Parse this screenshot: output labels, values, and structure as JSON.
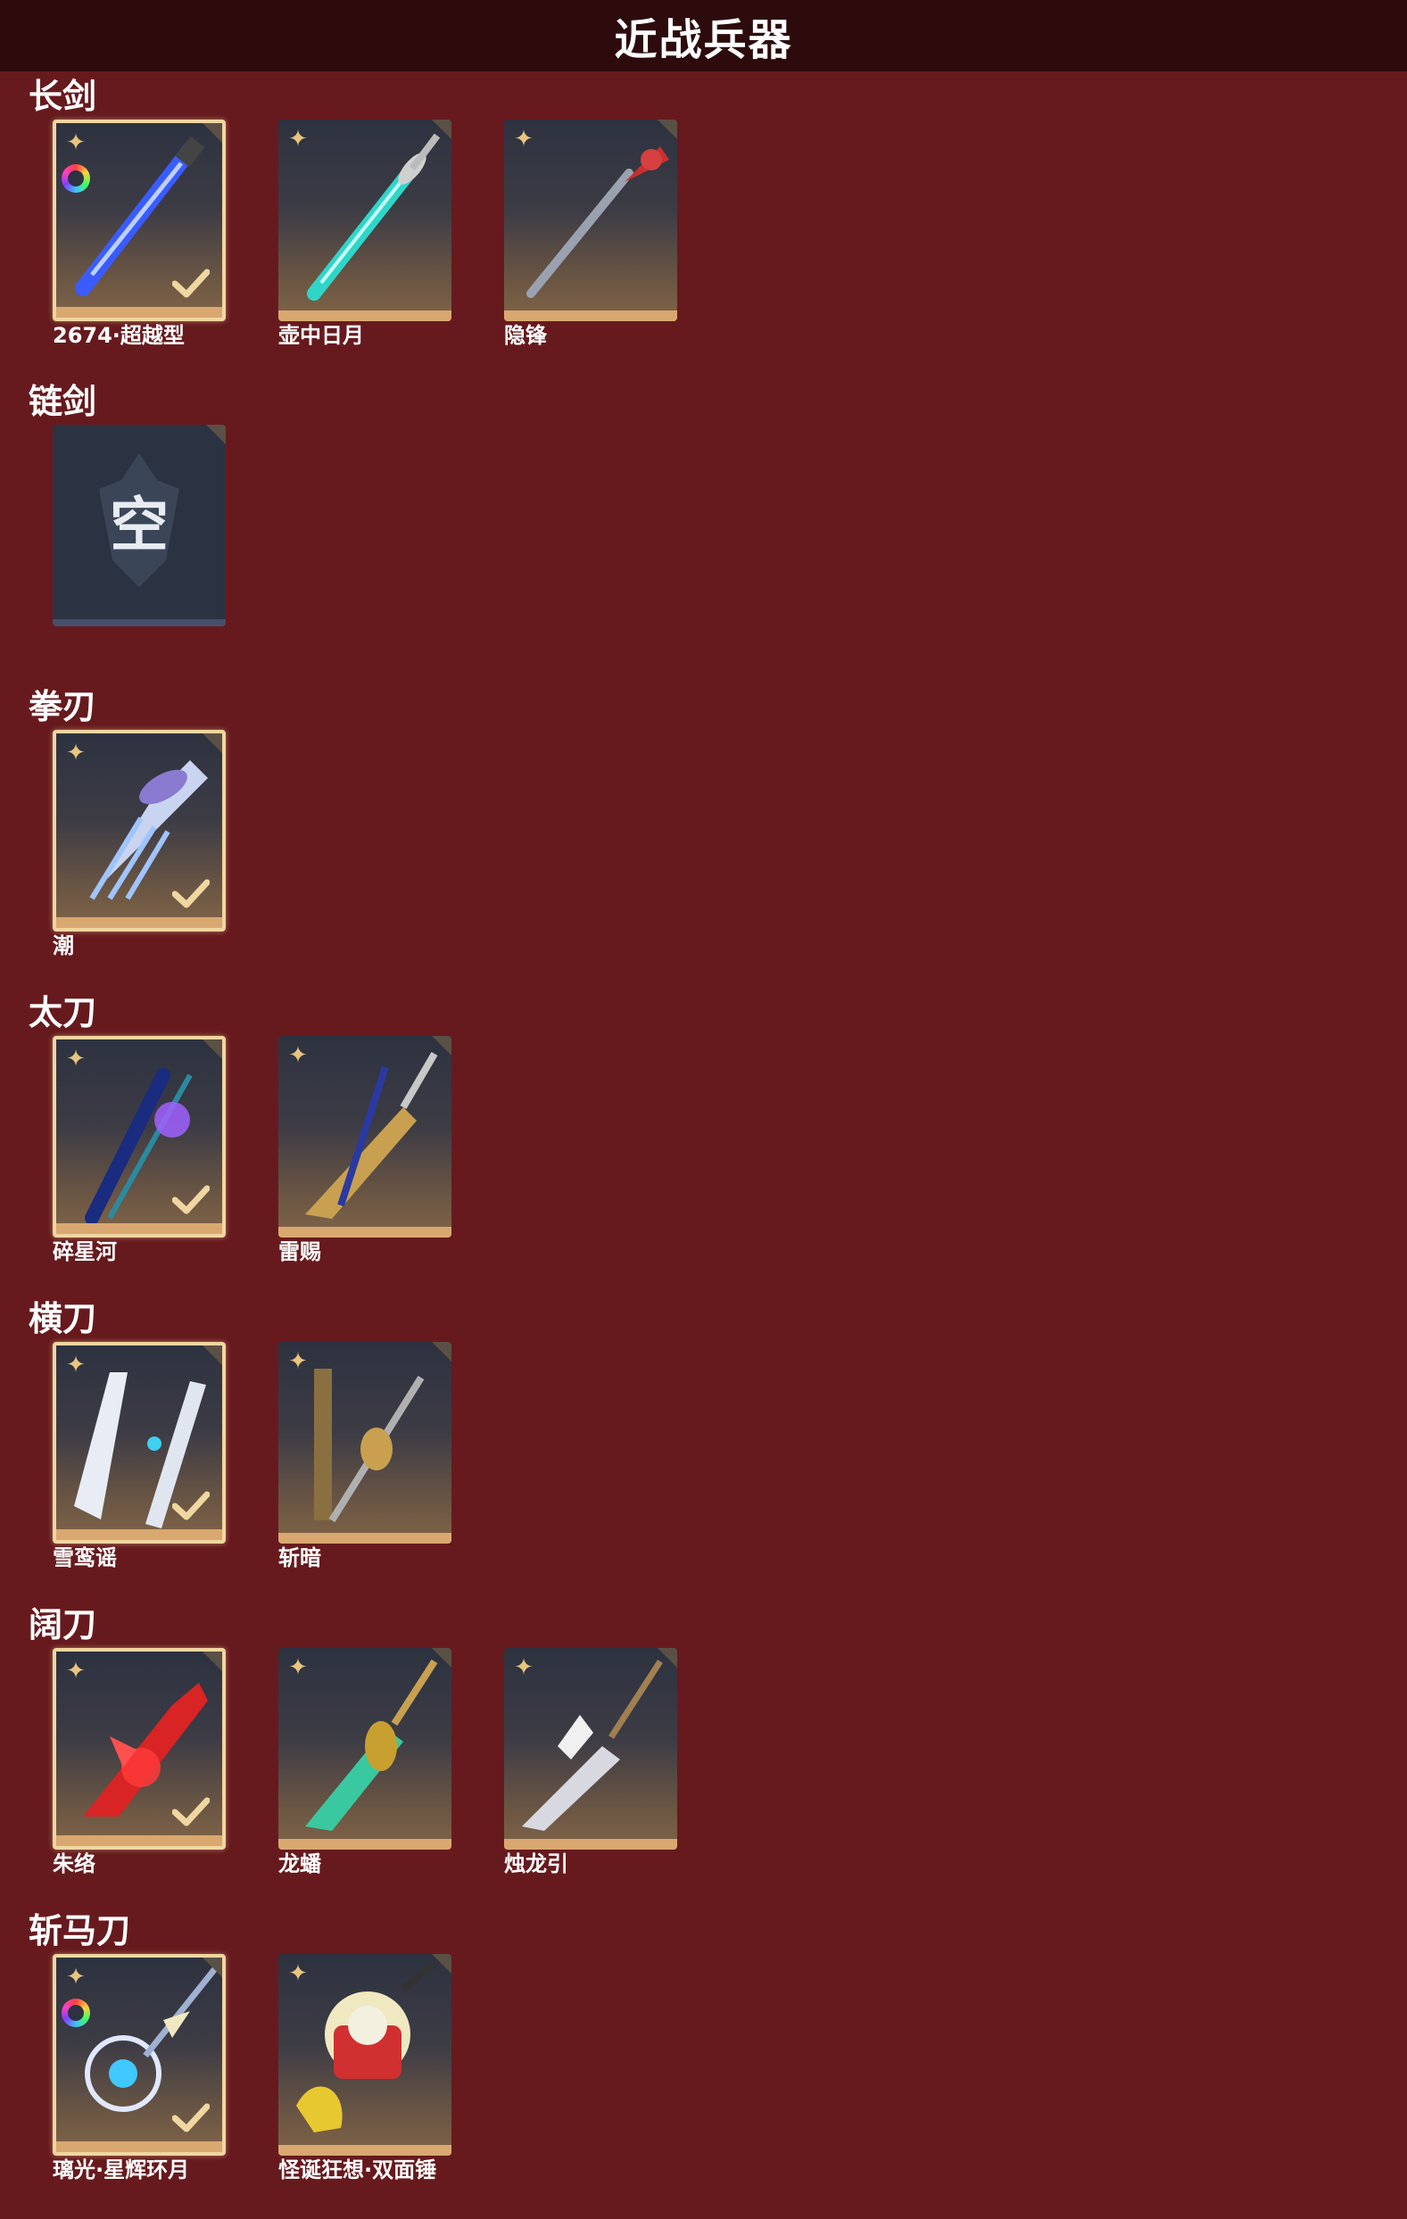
{
  "header": {
    "title": "近战兵器"
  },
  "sections": [
    {
      "title": "长剑",
      "items": [
        {
          "label": "2674·超越型",
          "selected": true,
          "rainbow": true,
          "weapon": "blue-sword"
        },
        {
          "label": "壶中日月",
          "selected": false,
          "rainbow": false,
          "weapon": "teal-sword"
        },
        {
          "label": "隐锋",
          "selected": false,
          "rainbow": false,
          "weapon": "red-sword"
        }
      ]
    },
    {
      "title": "链剑",
      "items": [
        {
          "label": "",
          "empty": true,
          "empty_text": "空"
        }
      ]
    },
    {
      "title": "拳刃",
      "items": [
        {
          "label": "潮",
          "selected": true,
          "rainbow": false,
          "weapon": "ice-claw"
        }
      ]
    },
    {
      "title": "太刀",
      "items": [
        {
          "label": "碎星河",
          "selected": true,
          "rainbow": false,
          "weapon": "purple-katana"
        },
        {
          "label": "雷赐",
          "selected": false,
          "rainbow": false,
          "weapon": "gold-katana"
        }
      ]
    },
    {
      "title": "横刀",
      "items": [
        {
          "label": "雪鸾谣",
          "selected": true,
          "rainbow": false,
          "weapon": "white-blade"
        },
        {
          "label": "斩暗",
          "selected": false,
          "rainbow": false,
          "weapon": "bronze-blade"
        }
      ]
    },
    {
      "title": "阔刀",
      "items": [
        {
          "label": "朱络",
          "selected": true,
          "rainbow": false,
          "weapon": "red-broad"
        },
        {
          "label": "龙蟠",
          "selected": false,
          "rainbow": false,
          "weapon": "jade-broad"
        },
        {
          "label": "烛龙引",
          "selected": false,
          "rainbow": false,
          "weapon": "silver-broad"
        }
      ]
    },
    {
      "title": "斩马刀",
      "items": [
        {
          "label": "璃光·星辉环月",
          "selected": true,
          "rainbow": true,
          "weapon": "moon-glaive"
        },
        {
          "label": "怪诞狂想·双面锤",
          "selected": false,
          "rainbow": false,
          "weapon": "toy-hammer"
        }
      ]
    }
  ],
  "icons": {
    "star": "four-point-star-icon",
    "check": "check-icon",
    "corner": "corner-tab-icon",
    "rainbow": "color-wheel-icon"
  },
  "colors": {
    "background": "#671a1e",
    "header": "#2d0b0c",
    "selected_border": "#f0d6a0",
    "star": "#e8c57e",
    "card_bottom": "#d9a870"
  }
}
